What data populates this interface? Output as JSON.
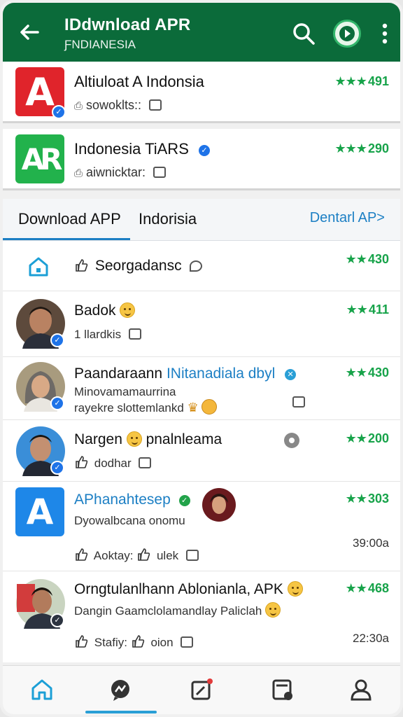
{
  "header": {
    "title": "IDdwnload APR",
    "subtitle": "ƑNDIANESIA",
    "icons": [
      "back-arrow-icon",
      "search-icon",
      "play-icon",
      "more-vert-icon"
    ],
    "brand_color": "#0b6b3a"
  },
  "apps": [
    {
      "name": "Altiuloat A Indonsia",
      "meta": "sowoklts::",
      "stars": "★★★",
      "rating": "491",
      "logo_letter": "A",
      "logo_color": "#e0242b"
    },
    {
      "name": "Indonesia TiARS",
      "meta": "aiwnicktar:",
      "stars": "★★★",
      "rating": "290",
      "logo_letter": "AR",
      "logo_color": "#22b24c"
    }
  ],
  "tabs": {
    "tab1": "Download APP",
    "tab2": "Indorisia",
    "tab3": "Dentarl AP>"
  },
  "feed": [
    {
      "title": "Seorgadansc",
      "stars": "★★",
      "rating": "430",
      "icon": "home-icon"
    },
    {
      "title": "Badok",
      "sub": "1 llardkis",
      "stars": "★★",
      "rating": "411"
    },
    {
      "title": "Paandaraann",
      "title_link": "INitanadiala dbyl",
      "sub1": "Minovamamaurrina",
      "sub2": "rayekre slottemlankd",
      "stars": "★★",
      "rating": "430"
    },
    {
      "title": "Nargen",
      "title2": "pnalnleama",
      "sub": "dodhar",
      "stars": "★★",
      "rating": "200"
    },
    {
      "title": "APhanahtesep",
      "sub": "Dyowalbcana onomu",
      "actions": "Aoktay:",
      "actions2": "ulek",
      "stars": "★★",
      "rating": "303",
      "time": "39:00a"
    },
    {
      "title": "Orngtulanlhann Ablonianla, APK",
      "sub": "Dangin Gaamclolamandlay Paliclah",
      "actions": "Stafiy:",
      "actions2": "oion",
      "stars": "★★",
      "rating": "468",
      "time": "22:30a"
    }
  ],
  "bottom_nav": [
    "home-icon",
    "chat-icon",
    "edit-notification-icon",
    "cards-icon",
    "profile-icon"
  ],
  "colors": {
    "accent_blue": "#1c7fc4",
    "rating_green": "#17a34a"
  }
}
